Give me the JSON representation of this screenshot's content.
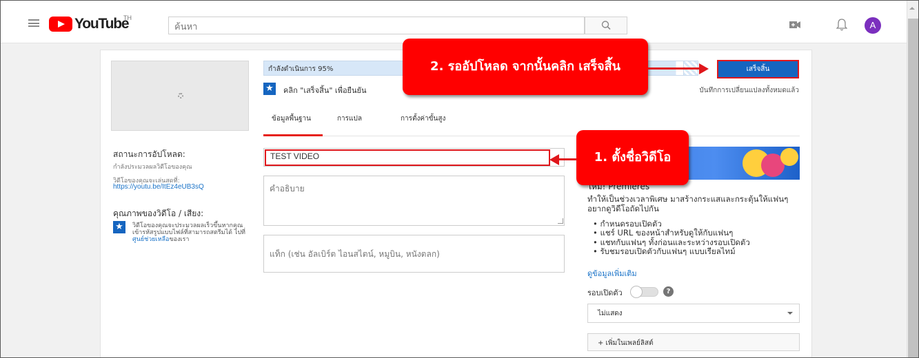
{
  "header": {
    "logo_text": "YouTube",
    "region": "TH",
    "search_placeholder": "ค้นหา",
    "avatar_letter": "A"
  },
  "upload": {
    "progress_label": "กำลังดำเนินการ 95%",
    "progress_value": 0.95,
    "confirm_text": "คลิก \"เสร็จสิ้น\" เพื่อยืนยัน",
    "saved_text": "บันทึกการเปลี่ยนแปลงทั้งหมดแล้ว",
    "done_label": "เสร็จสิ้น"
  },
  "tabs": [
    {
      "label": "ข้อมูลพื้นฐาน",
      "active": true
    },
    {
      "label": "การแปล",
      "active": false
    },
    {
      "label": "การตั้งค่าขั้นสูง",
      "active": false
    }
  ],
  "left_info": {
    "status_title": "สถานะการอัปโหลด:",
    "status_desc": "กำลังประมวลผลวิดีโอของคุณ",
    "watch_label": "วิดีโอของคุณจะเล่นสดที่:",
    "watch_link": "https://youtu.be/ItEz4eUB3sQ",
    "quality_title": "คุณภาพของวิดีโอ / เสียง:",
    "quality_text": "วิดีโอของคุณจะประมวลผลเร็วขึ้นหากคุณเข้ารหัสรูปแบบไฟล์ที่สามารถสตรีมได้ ไปที่",
    "quality_link": "ศูนย์ช่วยเหลือ",
    "quality_suffix": "ของเรา"
  },
  "form": {
    "title_value": "TEST VIDEO",
    "description_placeholder": "คำอธิบาย",
    "tags_placeholder": "แท็ก (เช่น อัลเบิร์ต ไอนสไตน์, หมูบิน, หนังตลก)"
  },
  "promo": {
    "title": "ใหม่! Premieres",
    "body": "ทำให้เป็นช่วงเวลาพิเศษ มาสร้างกระแสและกระตุ้นให้แฟนๆ อยากดูวิดีโอถัดไปกัน",
    "bullets": [
      "กำหนดรอบเปิดตัว",
      "แชร์ URL ของหน้าสำหรับดูให้กับแฟนๆ",
      "แชทกับแฟนๆ ทั้งก่อนและระหว่างรอบเปิดตัว",
      "รับชมรอบเปิดตัวกับแฟนๆ แบบเรียลไทม์"
    ],
    "more_link": "ดูข้อมูลเพิ่มเติม",
    "premiere_label": "รอบเปิดตัว",
    "help_glyph": "?",
    "visibility_value": "ไม่แสดง",
    "playlist_label": "+ เพิ่มในเพลย์ลิสต์"
  },
  "annotations": {
    "step2": "2. รออัปโหลด จากนั้นคลิก เสร็จสิ้น",
    "step1": "1. ตั้งชื่อวิดีโอ"
  },
  "colors": {
    "brand_red": "#ff0000",
    "primary_blue": "#1565c0",
    "annotation_red": "#e0161b"
  }
}
